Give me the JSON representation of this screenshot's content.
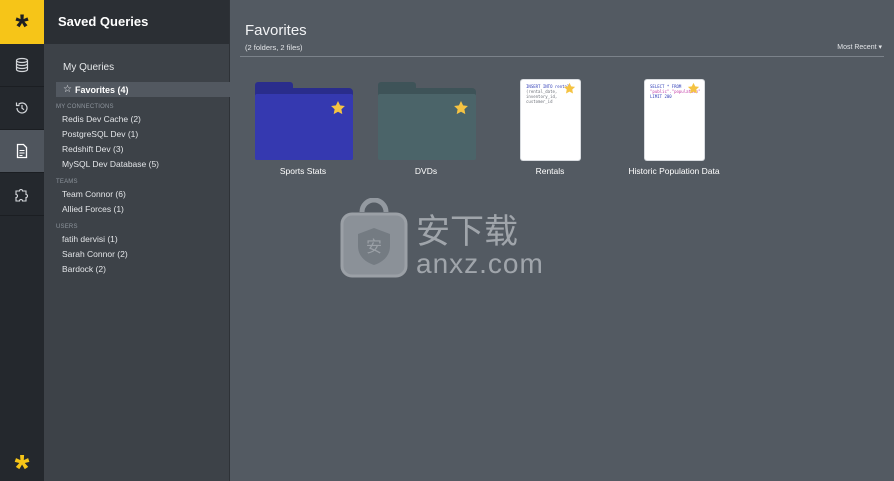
{
  "rail": {
    "logo": "*",
    "items": [
      "database-icon",
      "history-icon",
      "document-icon",
      "puzzle-icon"
    ],
    "active_index": 2,
    "footer_logo": "*"
  },
  "sidebar": {
    "title": "Saved Queries",
    "my_queries": "My Queries",
    "favorites": "Favorites (4)",
    "sections": [
      {
        "heading": "MY CONNECTIONS",
        "items": [
          "Redis Dev Cache (2)",
          "PostgreSQL Dev (1)",
          "Redshift Dev (3)",
          "MySQL Dev Database (5)"
        ]
      },
      {
        "heading": "TEAMS",
        "items": [
          "Team Connor (6)",
          "Allied Forces (1)"
        ]
      },
      {
        "heading": "USERS",
        "items": [
          "fatih dervisi (1)",
          "Sarah Connor (2)",
          "Bardock (2)"
        ]
      }
    ]
  },
  "main": {
    "title": "Favorites",
    "subtitle": "(2 folders, 2 files)",
    "sort_label": "Most Recent ▾",
    "tiles": [
      {
        "type": "folder",
        "name": "Sports Stats",
        "color": "#3236a6",
        "favorite": true
      },
      {
        "type": "folder",
        "name": "DVDs",
        "color": "#4b6469",
        "favorite": true
      },
      {
        "type": "file",
        "name": "Rentals",
        "favorite": true,
        "preview": [
          "INSERT INTO rental",
          "(rental_date, inventory_id,",
          "customer_id"
        ]
      },
      {
        "type": "file",
        "name": "Historic Population Data",
        "favorite": true,
        "preview": [
          "SELECT * FROM",
          "\"public\".\"population\"",
          "LIMIT 200"
        ]
      }
    ]
  },
  "watermark": {
    "chinese": "安下载",
    "domain": "anxz.com"
  },
  "colors": {
    "accent": "#f6c518",
    "star": "#f5c342"
  }
}
